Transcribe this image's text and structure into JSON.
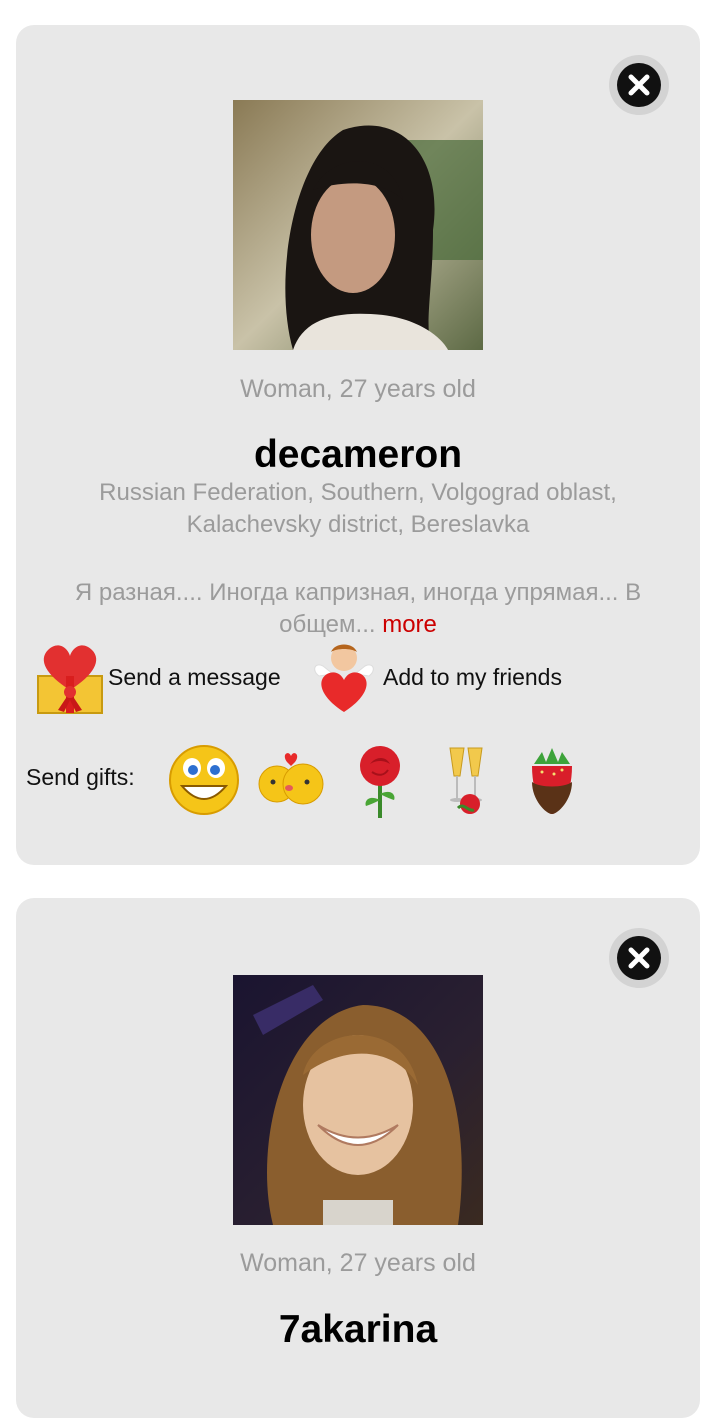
{
  "profiles": [
    {
      "meta": "Woman, 27 years old",
      "username": "decameron",
      "location": "Russian Federation, Southern, Volgograd oblast, Kalachevsky district, Bereslavka",
      "about": "Я разная.... Иногда капризная, иногда упрямая... В общем... ",
      "more_label": "more",
      "send_message_label": "Send a message",
      "add_friend_label": "Add to my friends",
      "send_gifts_label": "Send gifts:",
      "gifts": [
        "smiley-gift-icon",
        "kiss-gift-icon",
        "rose-gift-icon",
        "champagne-gift-icon",
        "strawberry-gift-icon"
      ]
    },
    {
      "meta": "Woman, 27 years old",
      "username": "7akarina"
    }
  ],
  "colors": {
    "card_bg": "#e8e8e8",
    "more_link": "#cc0000",
    "muted_text": "#9b9b9b"
  }
}
